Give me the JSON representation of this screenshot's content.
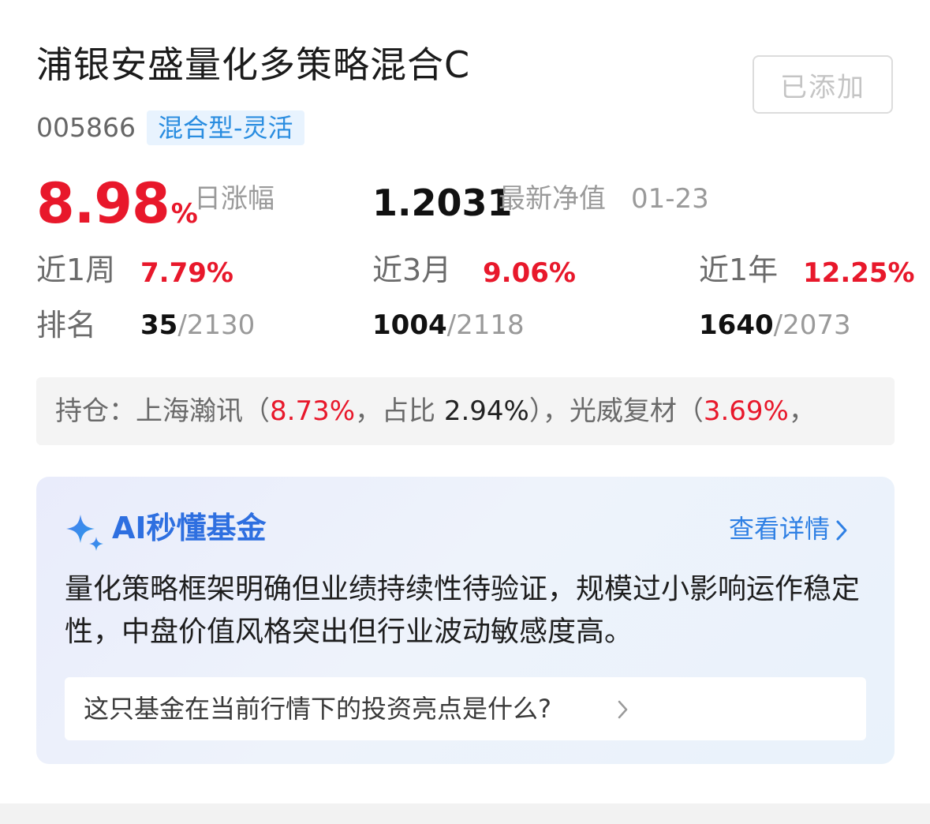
{
  "fund": {
    "name": "浦银安盛量化多策略混合C",
    "code": "005866",
    "type_tag": "混合型-灵活",
    "follow_button": "已添加"
  },
  "daily": {
    "change_value": "8.98",
    "change_unit": "%",
    "change_label": "日涨幅",
    "nav_value": "1.2031",
    "nav_label": "最新净值",
    "nav_date": "01-23"
  },
  "periods": [
    {
      "label": "近1周",
      "return": "7.79%",
      "rank": "35",
      "total": "/2130"
    },
    {
      "label": "近3月",
      "return": "9.06%",
      "rank": "1004",
      "total": "/2118"
    },
    {
      "label": "近1年",
      "return": "12.25%",
      "rank": "1640",
      "total": "/2073"
    }
  ],
  "rank_label": "排名",
  "holdings": {
    "prefix": "持仓：",
    "h1_name": "上海瀚讯",
    "h1_open": "（",
    "h1_change": "8.73%",
    "h1_mid": "，占比 ",
    "h1_ratio": "2.94%",
    "h1_close": "），",
    "h2_name": "光威复材",
    "h2_open": "（",
    "h2_change": "3.69%",
    "h2_tail": "，"
  },
  "ai": {
    "title": "AI秒懂基金",
    "detail_link": "查看详情",
    "summary": "量化策略框架明确但业绩持续性待验证，规模过小影响运作稳定性，中盘价值风格突出但行业波动敏感度高。",
    "question": "这只基金在当前行情下的投资亮点是什么?"
  },
  "colors": {
    "up_red": "#e8182b",
    "accent_blue": "#2f80e4",
    "tag_bg": "#e8f3fe"
  }
}
